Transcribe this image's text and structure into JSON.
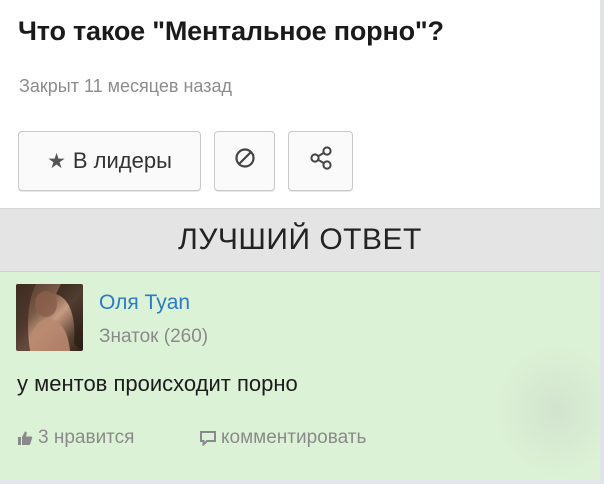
{
  "question": {
    "title": "Что такое \"Ментальное порно\"?",
    "status": "Закрыт 11 месяцев назад"
  },
  "actions": {
    "leaders_label": "В лидеры",
    "leaders_icon": "star-icon",
    "block_icon": "block-icon",
    "share_icon": "share-icon"
  },
  "best_answer": {
    "header": "ЛУЧШИЙ ОТВЕТ",
    "author": {
      "name": "Оля Tyan",
      "rank": "Знаток (260)"
    },
    "text": "у ментов происходит порно",
    "likes_label": "3 нравится",
    "comment_label": "комментировать"
  },
  "colors": {
    "link": "#2a7bc4",
    "answer_bg": "#dcf2d6",
    "header_bg": "#e4e4e4"
  }
}
